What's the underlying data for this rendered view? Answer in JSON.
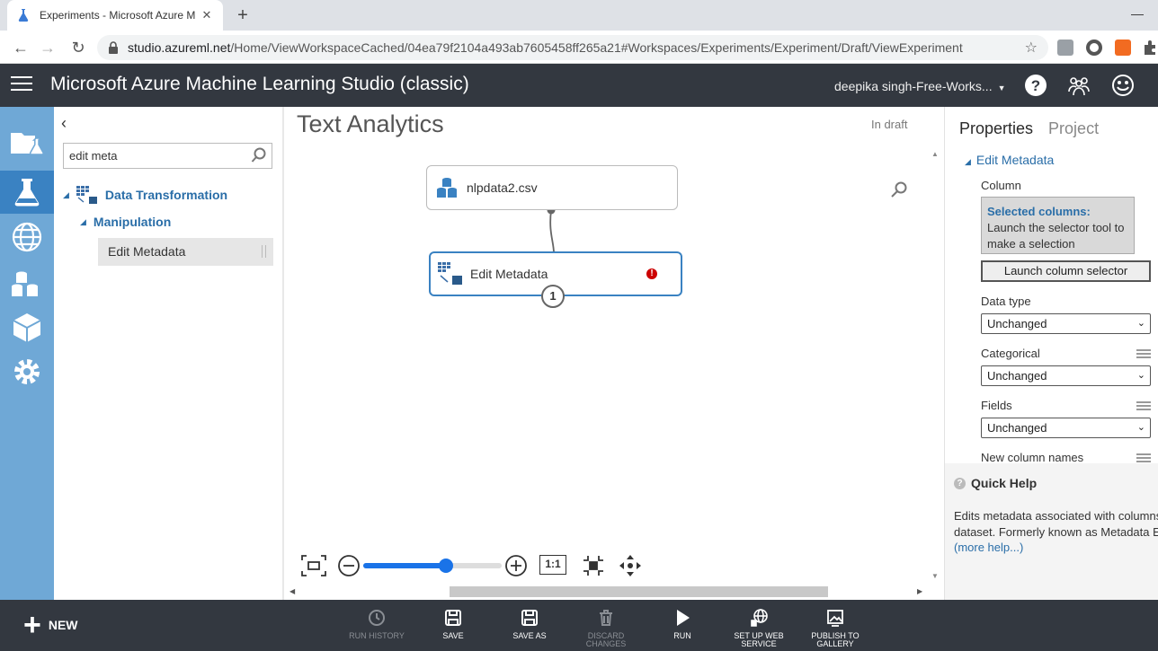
{
  "browser": {
    "tab_title": "Experiments - Microsoft Azure M",
    "close_glyph": "✕",
    "new_tab_glyph": "+",
    "url_host": "studio.azureml.net",
    "url_path": "/Home/ViewWorkspaceCached/04ea79f2104a493ab7605458ff265a21#Workspaces/Experiments/Experiment/Draft/ViewExperiment",
    "star_glyph": "☆",
    "back_glyph": "←",
    "forward_glyph": "→",
    "reload_glyph": "↻",
    "minimize_glyph": "—"
  },
  "header": {
    "app_title": "Microsoft Azure Machine Learning Studio (classic)",
    "workspace": "deepika singh-Free-Works...",
    "caret": "▼"
  },
  "palette": {
    "collapse_glyph": "‹",
    "search_value": "edit meta",
    "category": "Data Transformation",
    "subcategory": "Manipulation",
    "module": "Edit Metadata",
    "expand_glyph": "◢"
  },
  "canvas": {
    "experiment_title": "Text Analytics",
    "status": "In draft",
    "node_dataset": "nlpdata2.csv",
    "node_module": "Edit Metadata",
    "error_glyph": "!",
    "port_badge": "1",
    "scroll_up": "▲",
    "scroll_down": "▼",
    "scroll_left": "◀",
    "scroll_right": "▶",
    "zoom_reset": "1:1",
    "zoom_level": 0.6
  },
  "properties": {
    "tab_properties": "Properties",
    "tab_project": "Project",
    "section": "Edit Metadata",
    "column_label": "Column",
    "selected_heading": "Selected columns:",
    "selected_text": "Launch the selector tool to make a selection",
    "launch_button": "Launch column selector",
    "data_type_label": "Data type",
    "data_type_value": "Unchanged",
    "categorical_label": "Categorical",
    "categorical_value": "Unchanged",
    "fields_label": "Fields",
    "fields_value": "Unchanged",
    "new_names_label": "New column names",
    "dropdown_glyph": "⌄"
  },
  "quick_help": {
    "heading": "Quick Help",
    "help_glyph": "?",
    "line1": "Edits metadata associated with columns",
    "line2": "dataset. Formerly known as Metadata Ed",
    "more": "(more help...)"
  },
  "commands": {
    "new": "NEW",
    "run_history": "RUN HISTORY",
    "save": "SAVE",
    "save_as": "SAVE AS",
    "discard": "DISCARD CHANGES",
    "run": "RUN",
    "web_service_1": "SET UP WEB",
    "web_service_2": "SERVICE",
    "publish_1": "PUBLISH TO",
    "publish_2": "GALLERY"
  },
  "colors": {
    "header_bg": "#333840",
    "rail_bg": "#6fa8d6",
    "accent": "#2a6ea8",
    "error": "#cc0000"
  }
}
